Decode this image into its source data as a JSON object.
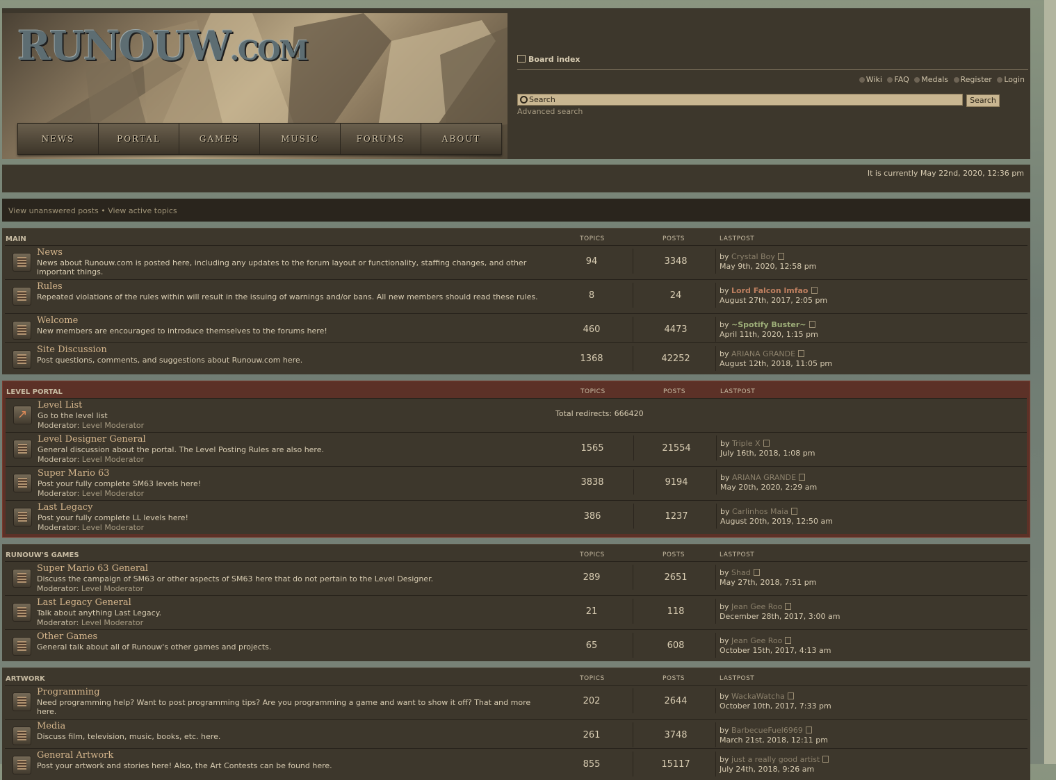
{
  "header": {
    "logo_text": "RUNOUW",
    "logo_suffix": ".COM",
    "nav": [
      "NEWS",
      "PORTAL",
      "GAMES",
      "MUSIC",
      "FORUMS",
      "ABOUT"
    ],
    "board_index": "Board index",
    "user_links": {
      "wiki": "Wiki",
      "faq": "FAQ",
      "medals": "Medals",
      "register": "Register",
      "login": "Login"
    },
    "search_placeholder": "Search",
    "search_button": "Search",
    "advanced_search": "Advanced search"
  },
  "time_text": "It is currently May 22nd, 2020, 12:36 pm",
  "links": {
    "unanswered": "View unanswered posts",
    "sep": "•",
    "active": "View active topics"
  },
  "columns": {
    "topics": "TOPICS",
    "posts": "POSTS",
    "lastpost": "LASTPOST"
  },
  "categories": [
    {
      "name": "MAIN",
      "forums": [
        {
          "title": "News",
          "desc": "News about Runouw.com is posted here, including any updates to the forum layout or functionality, staffing changes, and other important things.",
          "topics": "94",
          "posts": "3348",
          "by": "by",
          "author": "Crystal Boy",
          "date": "May 9th, 2020, 12:58 pm"
        },
        {
          "title": "Rules",
          "desc": "Repeated violations of the rules within will result in the issuing of warnings and/or bans. All new members should read these rules.",
          "topics": "8",
          "posts": "24",
          "by": "by",
          "author": "Lord Falcon lmfao",
          "date": "August 27th, 2017, 2:05 pm"
        },
        {
          "title": "Welcome",
          "desc": "New members are encouraged to introduce themselves to the forums here!",
          "topics": "460",
          "posts": "4473",
          "by": "by",
          "author": "~Spotify Buster~",
          "date": "April 11th, 2020, 1:15 pm"
        },
        {
          "title": "Site Discussion",
          "desc": "Post questions, comments, and suggestions about Runouw.com here.",
          "topics": "1368",
          "posts": "42252",
          "by": "by",
          "author": "ARIANA GRANDE",
          "date": "August 12th, 2018, 11:05 pm"
        }
      ]
    },
    {
      "name": "LEVEL PORTAL",
      "forums": [
        {
          "title": "Level List",
          "desc": "Go to the level list",
          "mod_label": "Moderator:",
          "mod": "Level Moderator",
          "redirects": "Total redirects: 666420"
        },
        {
          "title": "Level Designer General",
          "desc": "General discussion about the portal. The Level Posting Rules are also here.",
          "mod_label": "Moderator:",
          "mod": "Level Moderator",
          "topics": "1565",
          "posts": "21554",
          "by": "by",
          "author": "Triple X",
          "date": "July 16th, 2018, 1:08 pm"
        },
        {
          "title": "Super Mario 63",
          "desc": "Post your fully complete SM63 levels here!",
          "mod_label": "Moderator:",
          "mod": "Level Moderator",
          "topics": "3838",
          "posts": "9194",
          "by": "by",
          "author": "ARIANA GRANDE",
          "date": "May 20th, 2020, 2:29 am"
        },
        {
          "title": "Last Legacy",
          "desc": "Post your fully complete LL levels here!",
          "mod_label": "Moderator:",
          "mod": "Level Moderator",
          "topics": "386",
          "posts": "1237",
          "by": "by",
          "author": "Carlinhos Maia",
          "date": "August 20th, 2019, 12:50 am"
        }
      ]
    },
    {
      "name": "RUNOUW'S GAMES",
      "forums": [
        {
          "title": "Super Mario 63 General",
          "desc": "Discuss the campaign of SM63 or other aspects of SM63 here that do not pertain to the Level Designer.",
          "mod_label": "Moderator:",
          "mod": "Level Moderator",
          "topics": "289",
          "posts": "2651",
          "by": "by",
          "author": "Shad",
          "date": "May 27th, 2018, 7:51 pm"
        },
        {
          "title": "Last Legacy General",
          "desc": "Talk about anything Last Legacy.",
          "mod_label": "Moderator:",
          "mod": "Level Moderator",
          "topics": "21",
          "posts": "118",
          "by": "by",
          "author": "Jean Gee Roo",
          "date": "December 28th, 2017, 3:00 am"
        },
        {
          "title": "Other Games",
          "desc": "General talk about all of Runouw's other games and projects.",
          "topics": "65",
          "posts": "608",
          "by": "by",
          "author": "Jean Gee Roo",
          "date": "October 15th, 2017, 4:13 am"
        }
      ]
    },
    {
      "name": "ARTWORK",
      "forums": [
        {
          "title": "Programming",
          "desc": "Need programming help? Want to post programming tips? Are you programming a game and want to show it off? That and more here.",
          "topics": "202",
          "posts": "2644",
          "by": "by",
          "author": "WackaWatcha",
          "date": "October 10th, 2017, 7:33 pm"
        },
        {
          "title": "Media",
          "desc": "Discuss film, television, music, books, etc. here.",
          "topics": "261",
          "posts": "3748",
          "by": "by",
          "author": "BarbecueFuel6969",
          "date": "March 21st, 2018, 12:11 pm"
        },
        {
          "title": "General Artwork",
          "desc": "Post your artwork and stories here! Also, the Art Contests can be found here.",
          "topics": "855",
          "posts": "15117",
          "by": "by",
          "author": "just a really good artist",
          "date": "July 24th, 2018, 9:26 am"
        }
      ]
    }
  ]
}
